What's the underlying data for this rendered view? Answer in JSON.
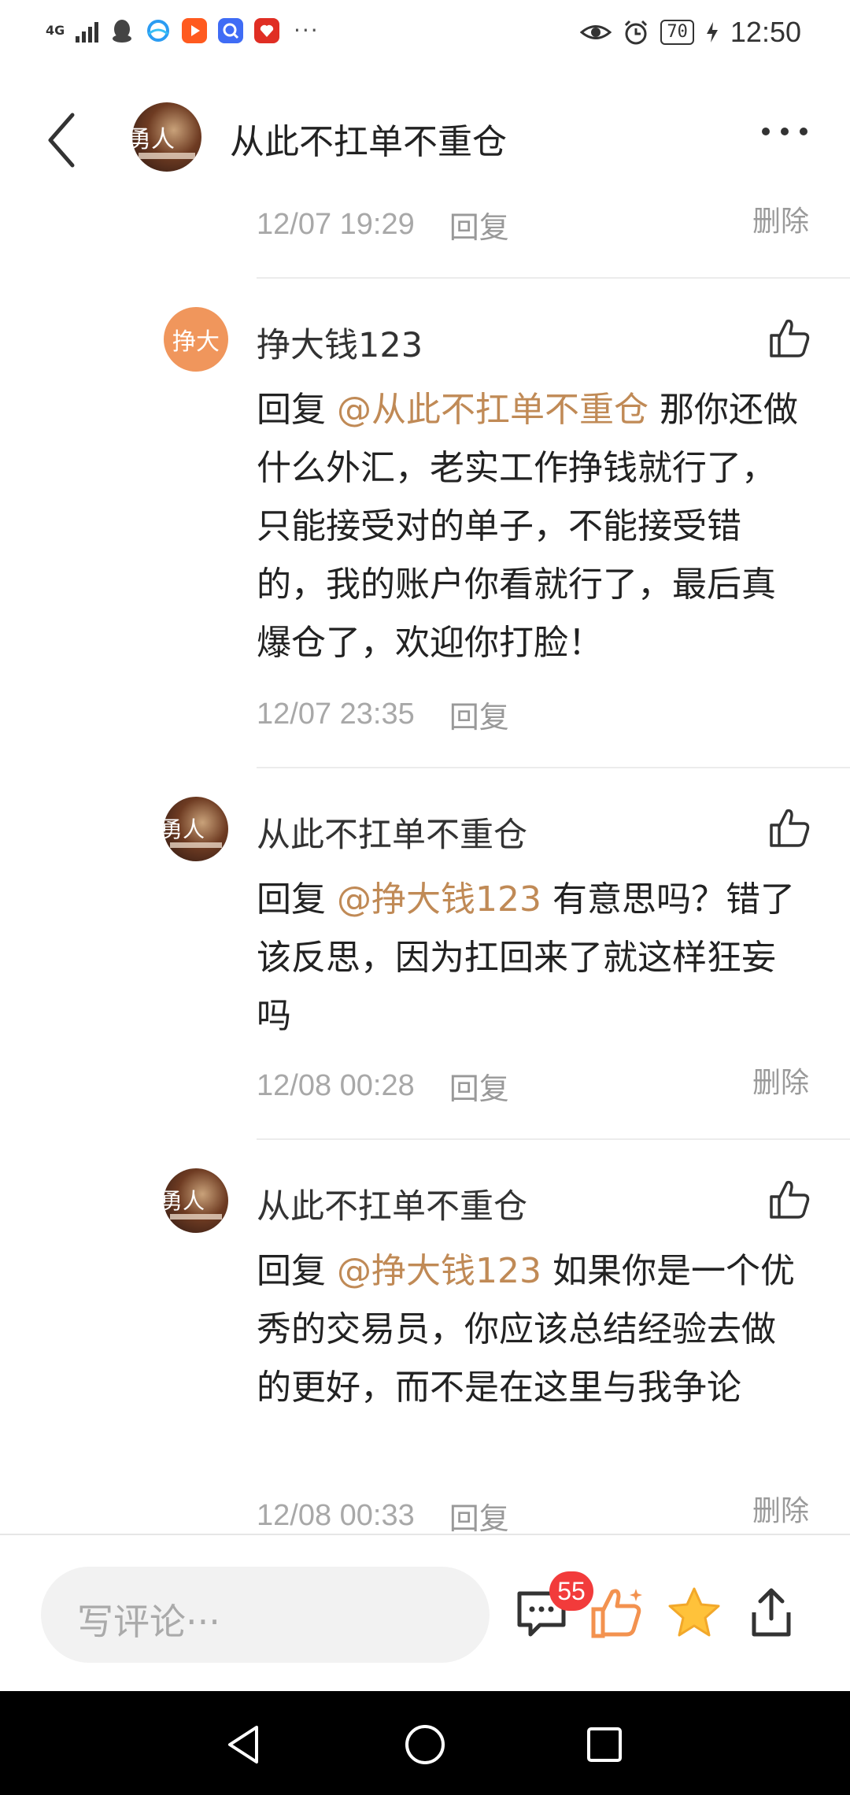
{
  "status_bar": {
    "network": "4G",
    "battery": "70",
    "time": "12:50",
    "app_icons": [
      "qq-icon",
      "browser-icon",
      "video-icon",
      "search-app-icon",
      "pinduoduo-icon"
    ],
    "overflow": "···"
  },
  "header": {
    "title": "从此不扛单不重仓",
    "avatar_text": "勇人"
  },
  "top_meta": {
    "time": "12/07 19:29",
    "reply": "回复",
    "delete": "删除"
  },
  "comments": [
    {
      "avatar_text": "挣大",
      "name": "挣大钱123",
      "reply_prefix": "回复",
      "mention": "@从此不扛单不重仓",
      "text": "那你还做什么外汇，老实工作挣钱就行了，只能接受对的单子，不能接受错的，我的账户你看就行了，最后真爆仓了，欢迎你打脸！",
      "time": "12/07 23:35",
      "reply": "回复"
    },
    {
      "avatar_text": "勇人",
      "name": "从此不扛单不重仓",
      "reply_prefix": "回复",
      "mention": "@挣大钱123",
      "text": "有意思吗？错了该反思，因为扛回来了就这样狂妄吗",
      "time": "12/08 00:28",
      "reply": "回复",
      "delete": "删除"
    },
    {
      "avatar_text": "勇人",
      "name": "从此不扛单不重仓",
      "reply_prefix": "回复",
      "mention": "@挣大钱123",
      "text": "如果你是一个优秀的交易员，你应该总结经验去做的更好，而不是在这里与我争论",
      "time": "12/08 00:33",
      "reply": "回复",
      "delete": "删除"
    }
  ],
  "bottom_bar": {
    "placeholder": "写评论···",
    "comment_count": "55"
  },
  "colors": {
    "mention": "#c08a56",
    "like_orange": "#f3924f",
    "star_yellow": "#ffc23a",
    "badge_red": "#f23b3b"
  }
}
